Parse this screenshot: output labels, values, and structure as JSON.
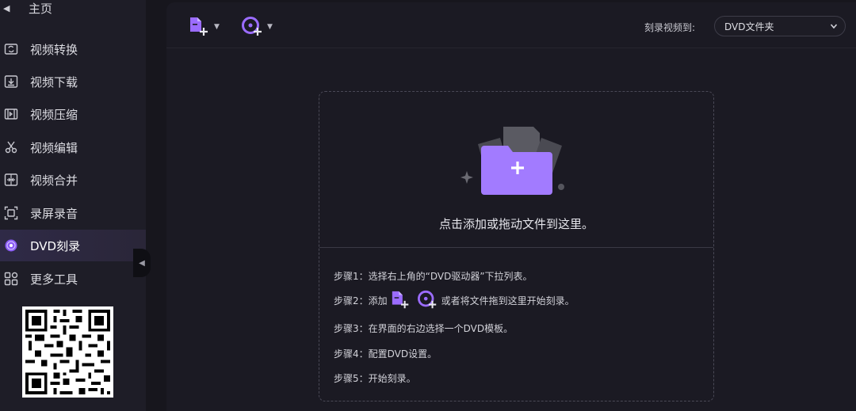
{
  "sidebar": {
    "home_label": "主页",
    "items": [
      {
        "label": "视频转换",
        "icon": "video-convert-icon"
      },
      {
        "label": "视频下载",
        "icon": "download-icon"
      },
      {
        "label": "视频压缩",
        "icon": "compress-icon"
      },
      {
        "label": "视频编辑",
        "icon": "scissors-icon"
      },
      {
        "label": "视频合并",
        "icon": "merge-icon"
      },
      {
        "label": "录屏录音",
        "icon": "screen-record-icon"
      },
      {
        "label": "DVD刻录",
        "icon": "dvd-disc-icon",
        "active": true
      },
      {
        "label": "更多工具",
        "icon": "grid-icon"
      }
    ]
  },
  "toolbar": {
    "add_file_icon": "add-file-icon",
    "add_disc_icon": "add-disc-icon",
    "burn_to_label": "刻录视频到:",
    "destination_value": "DVD文件夹"
  },
  "dropzone": {
    "prompt": "点击添加或拖动文件到这里。",
    "steps": {
      "s1": "步骤1：选择右上角的“DVD驱动器”下拉列表。",
      "s2_prefix": "步骤2：添加",
      "s2_suffix": "或者将文件拖到这里开始刻录。",
      "s3": "步骤3：在界面的右边选择一个DVD模板。",
      "s4": "步骤4：配置DVD设置。",
      "s5": "步骤5：开始刻录。"
    }
  },
  "colors": {
    "accent": "#9b6cff",
    "sidebar_bg": "#1e1d27",
    "main_bg": "#1b1a23",
    "active_item_bg": "#2f2a47"
  }
}
